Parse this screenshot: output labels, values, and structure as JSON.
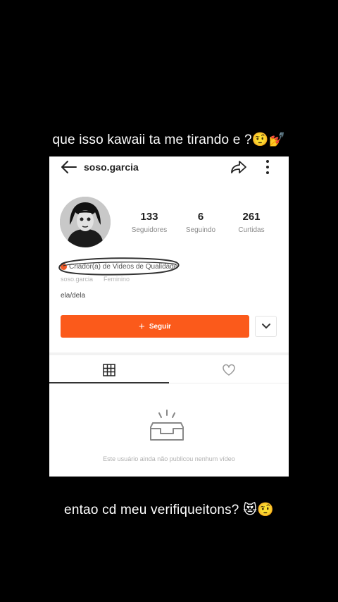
{
  "captions": {
    "top": "que isso kawaii ta me tirando e ?",
    "top_emoji": "🤨💅",
    "bottom": "entao cd meu verifiqueitons?",
    "bottom_emoji": "😻🤨"
  },
  "profile": {
    "username": "soso.garcia",
    "stats": [
      {
        "value": "133",
        "label": "Seguidores"
      },
      {
        "value": "6",
        "label": "Seguindo"
      },
      {
        "value": "261",
        "label": "Curtidas"
      }
    ],
    "badge": "Criador(a) de Videos de Qualidade",
    "sub_name": "soso.garcia",
    "sub_gender": "Feminino",
    "pronouns": "ela/dela",
    "follow_label": "Seguir"
  },
  "tabs": [
    {
      "icon": "grid-icon",
      "active": true
    },
    {
      "icon": "heart-icon",
      "active": false
    }
  ],
  "empty_state": {
    "icon": "inbox-icon",
    "text": "Este usuário ainda não publicou nenhum vídeo"
  },
  "colors": {
    "accent": "#fb5a1b",
    "badge": "#f05a28",
    "background": "#000000"
  }
}
